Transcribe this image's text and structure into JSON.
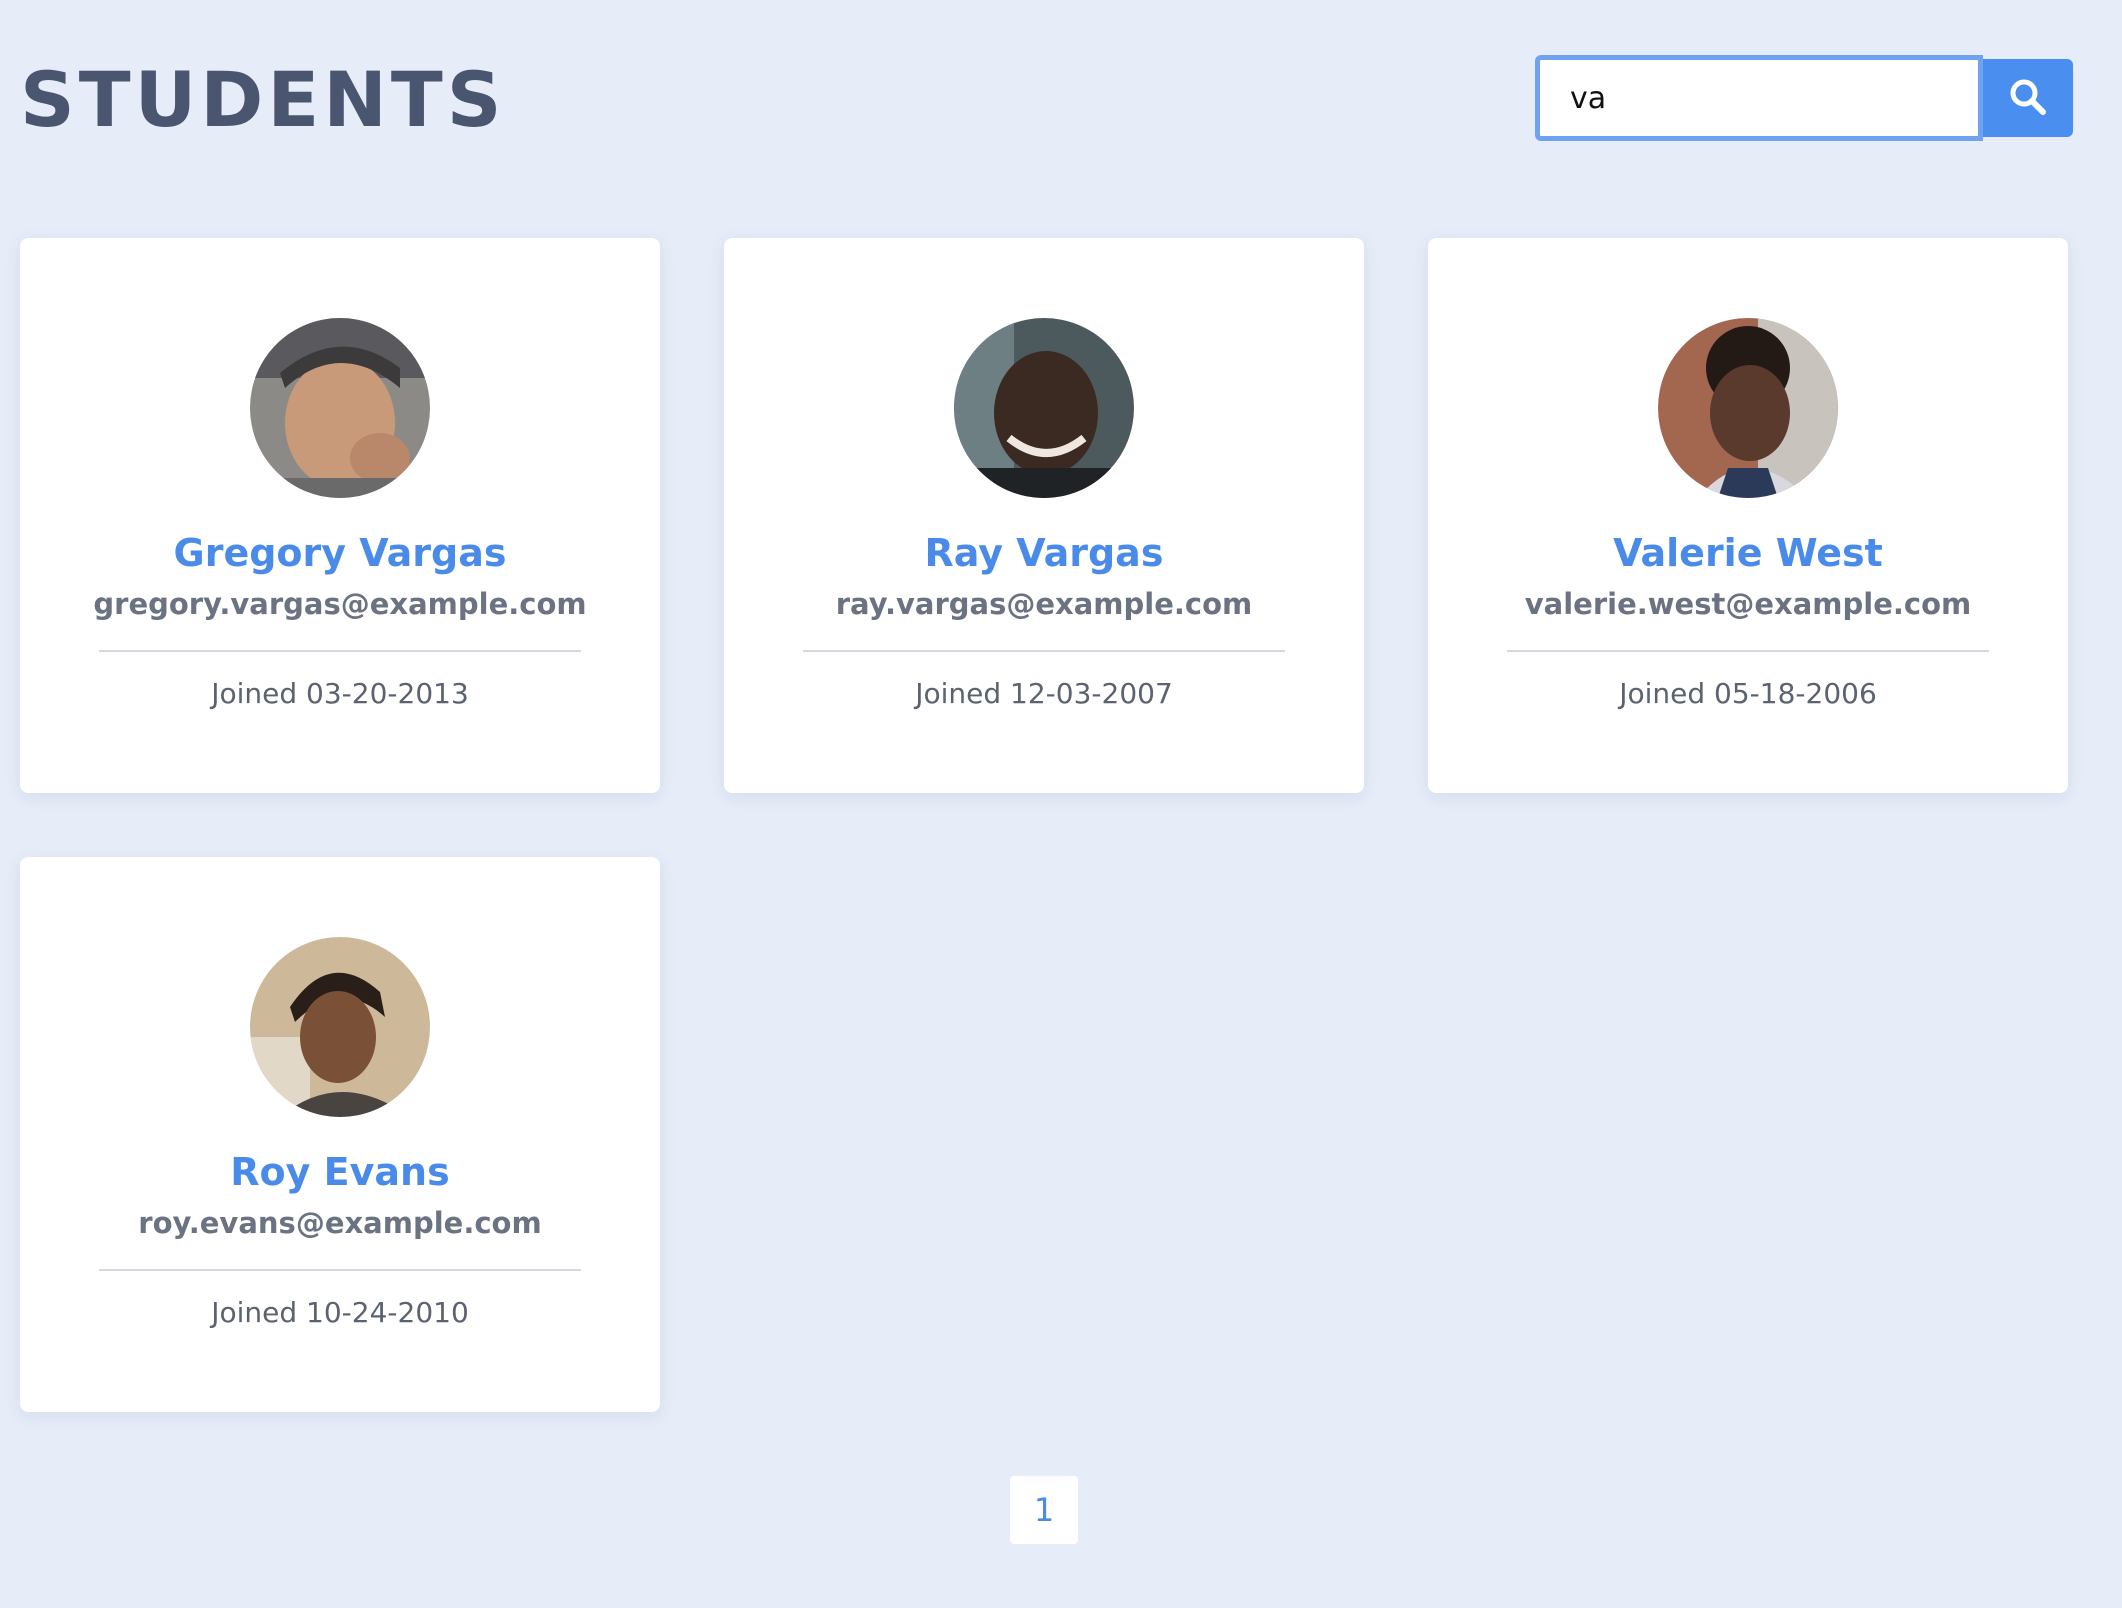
{
  "header": {
    "title": "STUDENTS"
  },
  "search": {
    "value": "va",
    "button_icon": "search-icon"
  },
  "students": [
    {
      "name": "Gregory Vargas",
      "email": "gregory.vargas@example.com",
      "joined": "Joined 03-20-2013"
    },
    {
      "name": "Ray Vargas",
      "email": "ray.vargas@example.com",
      "joined": "Joined 12-03-2007"
    },
    {
      "name": "Valerie West",
      "email": "valerie.west@example.com",
      "joined": "Joined 05-18-2006"
    },
    {
      "name": "Roy Evans",
      "email": "roy.evans@example.com",
      "joined": "Joined 10-24-2010"
    }
  ],
  "pagination": {
    "pages": [
      "1"
    ],
    "current": "1"
  },
  "colors": {
    "background": "#e6ecf8",
    "accent": "#4a8ff0",
    "name": "#4a8bea",
    "title": "#4a5570"
  }
}
